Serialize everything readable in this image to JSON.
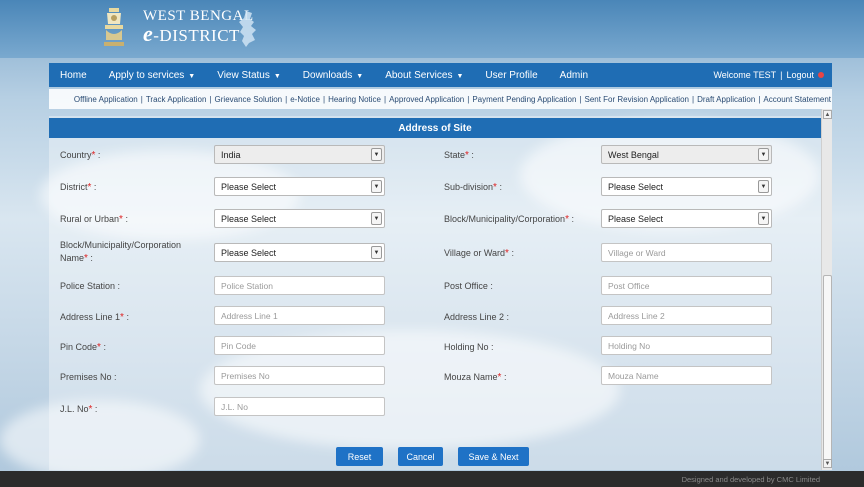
{
  "header": {
    "brand_line1": "WEST BENGAL",
    "brand_e": "e",
    "brand_line2": "-DISTRICT"
  },
  "nav": {
    "items": [
      {
        "label": "Home",
        "caret": false
      },
      {
        "label": "Apply to services",
        "caret": true
      },
      {
        "label": "View Status",
        "caret": true
      },
      {
        "label": "Downloads",
        "caret": true
      },
      {
        "label": "About Services",
        "caret": true
      },
      {
        "label": "User Profile",
        "caret": false
      },
      {
        "label": "Admin",
        "caret": false
      }
    ],
    "welcome": "Welcome TEST",
    "separator": "|",
    "logout": "Logout"
  },
  "subnav": {
    "links": [
      "Offline Application",
      "Track Application",
      "Grievance Solution",
      "e-Notice",
      "Hearing Notice",
      "Approved Application",
      "Payment Pending Application",
      "Sent For Revision Application",
      "Draft Application",
      "Account Statement"
    ]
  },
  "form": {
    "title": "Address of Site",
    "country_label": "Country",
    "country_value": "India",
    "state_label": "State",
    "state_value": "West Bengal",
    "district_label": "District",
    "district_value": "Please Select",
    "subdivision_label": "Sub-division",
    "subdivision_value": "Please Select",
    "rural_urban_label": "Rural or Urban",
    "rural_urban_value": "Please Select",
    "block_label": "Block/Municipality/Corporation",
    "block_value": "Please Select",
    "block_name_label_1": "Block/Municipality/Corporation",
    "block_name_label_2": "Name",
    "block_name_value": "Please Select",
    "village_label": "Village or Ward",
    "village_placeholder": "Village or Ward",
    "police_label": "Police Station :",
    "police_placeholder": "Police Station",
    "post_label": "Post Office :",
    "post_placeholder": "Post Office",
    "addr1_label": "Address Line 1",
    "addr1_placeholder": "Address Line 1",
    "addr2_label": "Address Line 2 :",
    "addr2_placeholder": "Address Line 2",
    "pin_label": "Pin Code",
    "pin_placeholder": "Pin Code",
    "holding_label": "Holding No :",
    "holding_placeholder": "Holding No",
    "premises_label": "Premises No :",
    "premises_placeholder": "Premises No",
    "mouza_label": "Mouza Name",
    "mouza_placeholder": "Mouza Name",
    "jl_label": "J.L. No",
    "jl_placeholder": "J.L. No",
    "required_mark": "*",
    "colon": " :"
  },
  "buttons": {
    "reset": "Reset",
    "cancel": "Cancel",
    "save_next": "Save & Next"
  },
  "footer": {
    "text": "Designed and developed by CMC Limited"
  },
  "colors": {
    "nav_blue": "#1f6db4",
    "button_blue": "#1f72c6",
    "required_red": "#d22222"
  }
}
